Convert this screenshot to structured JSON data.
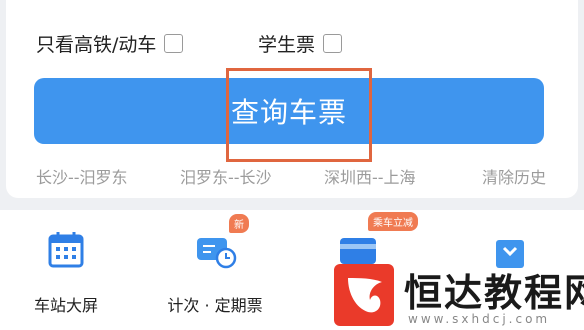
{
  "options": {
    "high_speed_only": {
      "label": "只看高铁/动车",
      "checked": false
    },
    "student_ticket": {
      "label": "学生票",
      "checked": false
    }
  },
  "query_button": {
    "label": "查询车票"
  },
  "history": {
    "items": [
      "长沙--汨罗东",
      "汨罗东--长沙",
      "深圳西--上海"
    ],
    "clear_label": "清除历史"
  },
  "nav": {
    "items": [
      {
        "label": "车站大屏",
        "icon": "calendar-grid-icon"
      },
      {
        "label": "计次 · 定期票",
        "icon": "ticket-clock-icon",
        "badge": "新"
      },
      {
        "label": "",
        "icon": "card-icon",
        "badge": "乘车立减"
      },
      {
        "label": "",
        "icon": "box-icon"
      }
    ]
  },
  "watermark": {
    "text": "恒达教程网",
    "url": "www.sxhdcj.com"
  },
  "colors": {
    "primary": "#3f95ee",
    "highlight_border": "#e0663f",
    "badge": "#f07b52",
    "logo": "#ea3a2a"
  }
}
